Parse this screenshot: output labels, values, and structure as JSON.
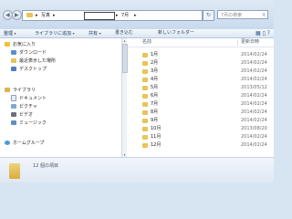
{
  "address": {
    "breadcrumb": [
      "写真",
      "7月"
    ],
    "separator": "▸",
    "search_placeholder": "7月の検索"
  },
  "toolbar": {
    "items": [
      "整理",
      "ライブラリに追加",
      "共有",
      "書き込む",
      "新しいフォルダー"
    ]
  },
  "nav": {
    "favorites": {
      "label": "お気に入り",
      "items": [
        "ダウンロード",
        "最近表示した場所",
        "デスクトップ"
      ]
    },
    "libraries": {
      "label": "ライブラリ",
      "items": [
        "ドキュメント",
        "ピクチャ",
        "ビデオ",
        "ミュージック"
      ]
    },
    "homegroup": "ホームグループ"
  },
  "list": {
    "columns": {
      "name": "名前",
      "date": "更新日時"
    },
    "rows": [
      {
        "name": "1月",
        "date": "2014/02/24"
      },
      {
        "name": "2月",
        "date": "2014/02/24"
      },
      {
        "name": "3月",
        "date": "2014/02/24"
      },
      {
        "name": "4月",
        "date": "2014/02/24"
      },
      {
        "name": "5月",
        "date": "2013/05/12"
      },
      {
        "name": "6月",
        "date": "2014/02/24"
      },
      {
        "name": "7月",
        "date": "2014/02/24"
      },
      {
        "name": "8月",
        "date": "2014/02/24"
      },
      {
        "name": "9月",
        "date": "2014/02/24"
      },
      {
        "name": "10月",
        "date": "2013/08/20"
      },
      {
        "name": "11月",
        "date": "2014/02/24"
      },
      {
        "name": "12月",
        "date": "2014/02/24"
      }
    ]
  },
  "status": {
    "item_count": "12 個の項目"
  }
}
